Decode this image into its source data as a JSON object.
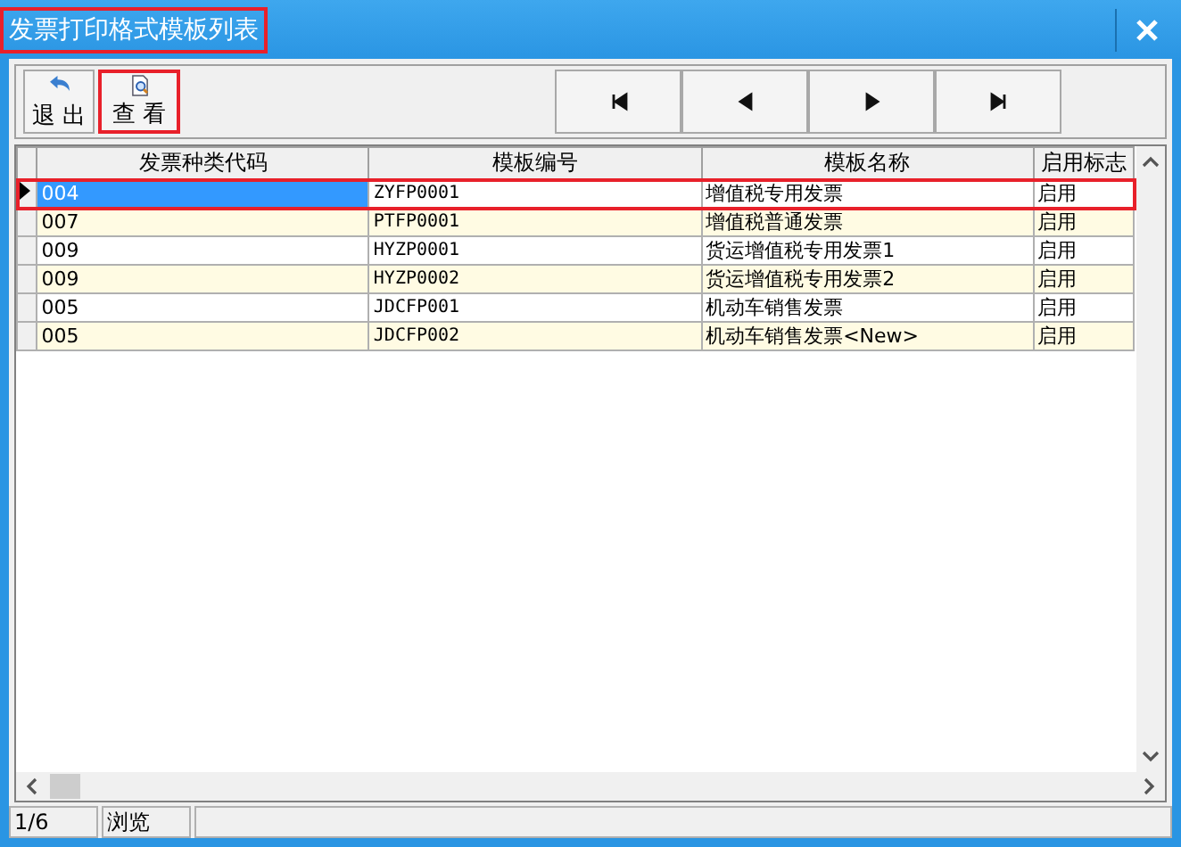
{
  "window": {
    "title": "发票打印格式模板列表",
    "title_highlighted": true
  },
  "toolbar": {
    "buttons": [
      {
        "label": "退 出",
        "kind": "exit",
        "highlighted": false
      },
      {
        "label": "查 看",
        "kind": "view",
        "highlighted": true
      }
    ],
    "nav": [
      {
        "kind": "first"
      },
      {
        "kind": "prev"
      },
      {
        "kind": "next"
      },
      {
        "kind": "last"
      }
    ]
  },
  "table": {
    "columns": [
      "发票种类代码",
      "模板编号",
      "模板名称",
      "启用标志"
    ],
    "rows": [
      {
        "cells": [
          "004",
          "ZYFP0001",
          "增值税专用发票",
          "启用"
        ],
        "selected": true,
        "highlighted": true
      },
      {
        "cells": [
          "007",
          "PTFP0001",
          "增值税普通发票",
          "启用"
        ],
        "selected": false,
        "highlighted": false
      },
      {
        "cells": [
          "009",
          "HYZP0001",
          "货运增值税专用发票1",
          "启用"
        ],
        "selected": false,
        "highlighted": false
      },
      {
        "cells": [
          "009",
          "HYZP0002",
          "货运增值税专用发票2",
          "启用"
        ],
        "selected": false,
        "highlighted": false
      },
      {
        "cells": [
          "005",
          "JDCFP001",
          "机动车销售发票",
          "启用"
        ],
        "selected": false,
        "highlighted": false
      },
      {
        "cells": [
          "005",
          "JDCFP002",
          "机动车销售发票<New>",
          "启用"
        ],
        "selected": false,
        "highlighted": false
      }
    ]
  },
  "status_bar": [
    "1/6",
    "浏览"
  ]
}
